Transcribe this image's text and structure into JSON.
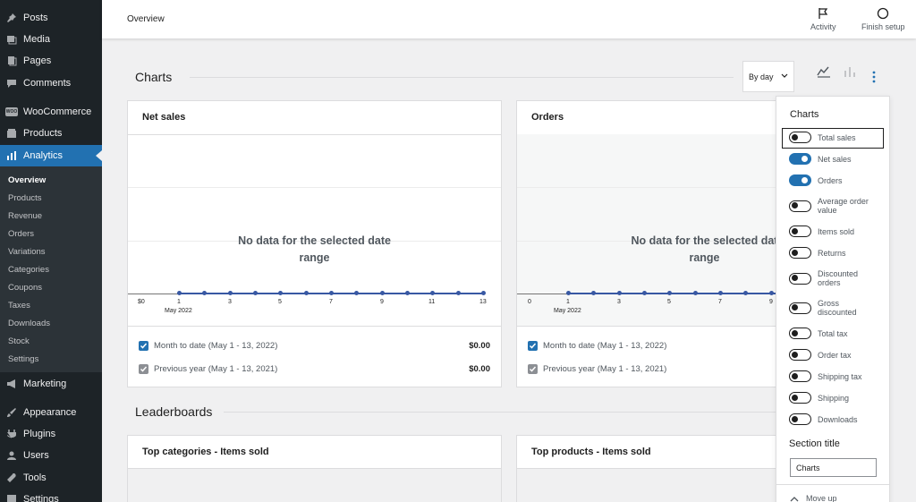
{
  "sidebar": {
    "menu": [
      {
        "label": "Posts",
        "icon": "pin-icon"
      },
      {
        "label": "Media",
        "icon": "media-icon"
      },
      {
        "label": "Pages",
        "icon": "pages-icon"
      },
      {
        "label": "Comments",
        "icon": "comments-icon"
      },
      {
        "label": "WooCommerce",
        "icon": "woocommerce-icon",
        "logo_text": "WOO"
      },
      {
        "label": "Products",
        "icon": "products-icon"
      },
      {
        "label": "Analytics",
        "icon": "analytics-icon"
      },
      {
        "label": "Marketing",
        "icon": "megaphone-icon"
      },
      {
        "label": "Appearance",
        "icon": "brush-icon"
      },
      {
        "label": "Plugins",
        "icon": "plugins-icon"
      },
      {
        "label": "Users",
        "icon": "users-icon"
      },
      {
        "label": "Tools",
        "icon": "tools-icon"
      },
      {
        "label": "Settings",
        "icon": "settings-icon"
      }
    ],
    "submenu": [
      "Overview",
      "Products",
      "Revenue",
      "Orders",
      "Variations",
      "Categories",
      "Coupons",
      "Taxes",
      "Downloads",
      "Stock",
      "Settings"
    ]
  },
  "header": {
    "title": "Overview",
    "activity_label": "Activity",
    "finish_setup_label": "Finish setup"
  },
  "charts_section": {
    "title": "Charts",
    "interval_value": "By day"
  },
  "cards": [
    {
      "title": "Net sales",
      "no_data_line1": "No data for the selected date",
      "no_data_line2": "range",
      "y_tick": "$0",
      "x_ticks": [
        "1",
        "3",
        "5",
        "7",
        "9",
        "11",
        "13"
      ],
      "x_sub": "May 2022",
      "legend": [
        {
          "label": "Month to date (May 1 - 13, 2022)",
          "value": "$0.00"
        },
        {
          "label": "Previous year (May 1 - 13, 2021)",
          "value": "$0.00"
        }
      ]
    },
    {
      "title": "Orders",
      "no_data_line1": "No data for the selected dat",
      "no_data_line2": "range",
      "y_tick": "0",
      "x_ticks": [
        "1",
        "3",
        "5",
        "7",
        "9"
      ],
      "x_sub": "May 2022",
      "legend": [
        {
          "label": "Month to date (May 1 - 13, 2022)"
        },
        {
          "label": "Previous year (May 1 - 13, 2021)"
        }
      ]
    }
  ],
  "leaderboards_section": {
    "title": "Leaderboards",
    "cards": [
      "Top categories - Items sold",
      "Top products - Items sold"
    ]
  },
  "panel": {
    "heading": "Charts",
    "toggles": [
      {
        "label": "Total sales",
        "on": false
      },
      {
        "label": "Net sales",
        "on": true
      },
      {
        "label": "Orders",
        "on": true
      },
      {
        "label": "Average order value",
        "on": false
      },
      {
        "label": "Items sold",
        "on": false
      },
      {
        "label": "Returns",
        "on": false
      },
      {
        "label": "Discounted orders",
        "on": false
      },
      {
        "label": "Gross discounted",
        "on": false
      },
      {
        "label": "Total tax",
        "on": false
      },
      {
        "label": "Order tax",
        "on": false
      },
      {
        "label": "Shipping tax",
        "on": false
      },
      {
        "label": "Shipping",
        "on": false
      },
      {
        "label": "Downloads",
        "on": false
      }
    ],
    "section_title_label": "Section title",
    "section_title_value": "Charts",
    "move_up_label": "Move up"
  },
  "colors": {
    "accent": "#2271b1",
    "sidebar_bg": "#1d2327",
    "chart_line": "#3858a3"
  }
}
